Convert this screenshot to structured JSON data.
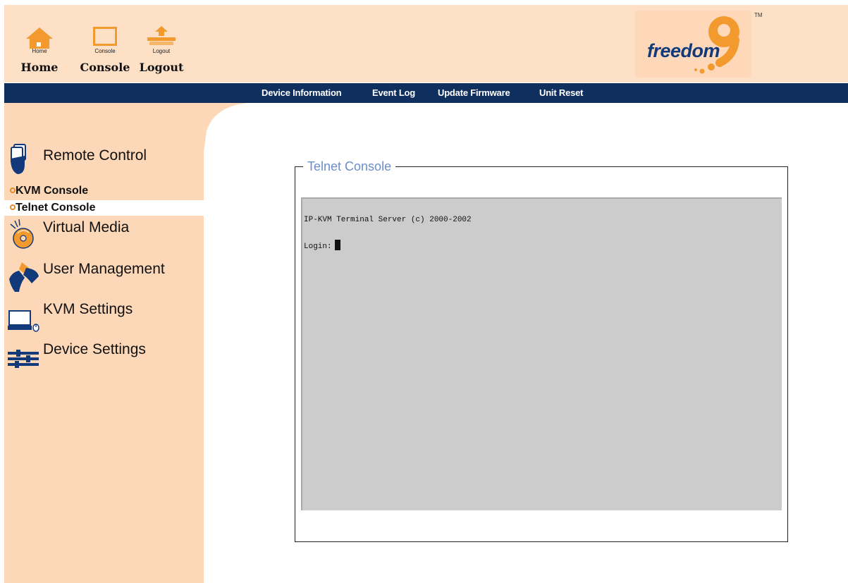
{
  "header": {
    "nav": [
      {
        "id": "home",
        "icon": "house-icon",
        "small_label": "Home",
        "label": "Home"
      },
      {
        "id": "console",
        "icon": "window-icon",
        "small_label": "Console",
        "label": "Console"
      },
      {
        "id": "logout",
        "icon": "logout-icon",
        "small_label": "Logout",
        "label": "Logout"
      }
    ],
    "brand": {
      "text": "freedom",
      "mark": "9",
      "tm": "TM"
    }
  },
  "subnav": {
    "links": [
      "Device Information",
      "Event Log",
      "Update Firmware",
      "Unit Reset"
    ]
  },
  "sidebar": {
    "remote_control": {
      "label": "Remote Control",
      "icon": "remote-hand-icon",
      "items": [
        "KVM Console",
        "Telnet Console"
      ],
      "active_item": "Telnet Console"
    },
    "sections": [
      {
        "label": "Virtual Media",
        "icon": "cd-disc-icon"
      },
      {
        "label": "User Management",
        "icon": "users-icon"
      },
      {
        "label": "KVM Settings",
        "icon": "computer-icon"
      },
      {
        "label": "Device Settings",
        "icon": "device-rack-icon"
      }
    ]
  },
  "main": {
    "panel_title": "Telnet Console",
    "terminal": {
      "line1": "IP-KVM Terminal Server (c) 2000-2002",
      "prompt": "Login:"
    }
  },
  "colors": {
    "header_bg": "#fde0c6",
    "sidebar_bg": "#fdd8b8",
    "nav_bar": "#0f2f5f",
    "accent_orange": "#f29a2e",
    "legend_blue": "#6c8ec9",
    "terminal_bg": "#cccccc",
    "brand_blue": "#123a7a"
  }
}
